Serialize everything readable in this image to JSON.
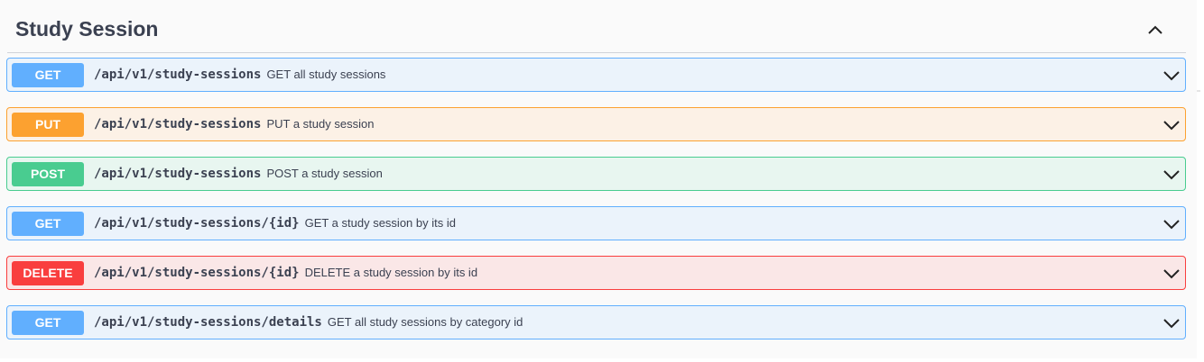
{
  "section": {
    "title": "Study Session",
    "collapse_icon": "chevron-up-icon"
  },
  "operations": [
    {
      "method": "GET",
      "path": "/api/v1/study-sessions",
      "summary": "GET all study sessions"
    },
    {
      "method": "PUT",
      "path": "/api/v1/study-sessions",
      "summary": "PUT a study session"
    },
    {
      "method": "POST",
      "path": "/api/v1/study-sessions",
      "summary": "POST a study session"
    },
    {
      "method": "GET",
      "path": "/api/v1/study-sessions/{id}",
      "summary": "GET a study session by its id"
    },
    {
      "method": "DELETE",
      "path": "/api/v1/study-sessions/{id}",
      "summary": "DELETE a study session by its id"
    },
    {
      "method": "GET",
      "path": "/api/v1/study-sessions/details",
      "summary": "GET all study sessions by category id"
    }
  ],
  "colors": {
    "get": "#61affe",
    "put": "#fca130",
    "post": "#49cc90",
    "delete": "#f93e3e",
    "text": "#3b4151"
  },
  "icons": {
    "expand": "chevron-down-icon"
  }
}
